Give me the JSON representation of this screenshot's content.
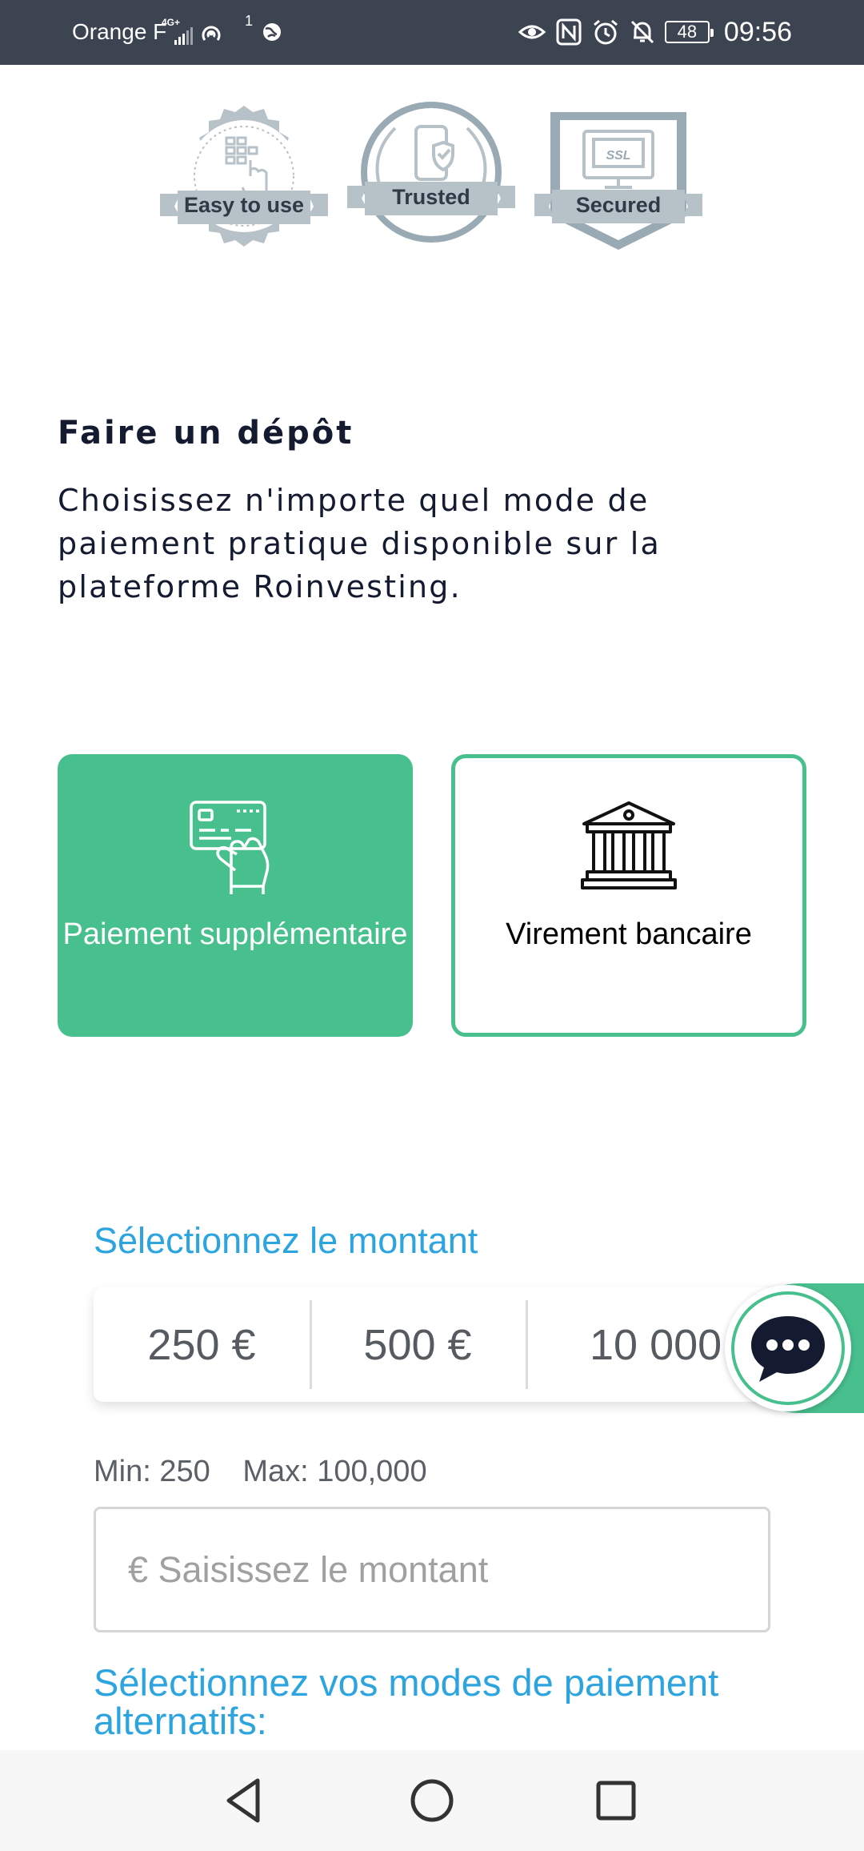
{
  "status_bar": {
    "carrier": "Orange F",
    "network": "4G+",
    "hotspot_count": "1",
    "battery": "48",
    "time": "09:56",
    "icons": [
      "signal-icon",
      "hotspot-icon",
      "globe-icon",
      "eye-icon",
      "nfc-icon",
      "alarm-icon",
      "mute-icon",
      "battery-icon"
    ]
  },
  "badges": [
    {
      "label": "Easy to use",
      "icon": "keypad-tap-icon"
    },
    {
      "label": "Trusted",
      "icon": "phone-shield-icon"
    },
    {
      "label": "Secured",
      "icon": "ssl-monitor-icon"
    }
  ],
  "deposit": {
    "title": "Faire un dépôt",
    "description": "Choisissez n'importe quel mode de paiement pratique disponible sur la plateforme Roinvesting."
  },
  "payment_methods": [
    {
      "label": "Paiement supplémentaire",
      "icon": "card-hand-icon",
      "selected": true
    },
    {
      "label": "Virement bancaire",
      "icon": "bank-icon",
      "selected": false
    }
  ],
  "amount": {
    "section_label": "Sélectionnez le montant",
    "options": [
      "250 €",
      "500 €",
      "10 000 €"
    ],
    "min_label": "Min: 250",
    "max_label": "Max: 100,000",
    "input_placeholder": "€ Saisissez le montant",
    "input_value": ""
  },
  "alternative_methods_label": "Sélectionnez vos modes de paiement alternatifs:",
  "chat": {
    "icon": "chat-bubble-icon"
  },
  "colors": {
    "accent_green": "#48c08e",
    "link_blue": "#2ba4e0",
    "status_bar": "#3d4451",
    "text_dark": "#141a30"
  },
  "nav_bar": {
    "buttons": [
      "back-icon",
      "home-icon",
      "recents-icon"
    ]
  }
}
